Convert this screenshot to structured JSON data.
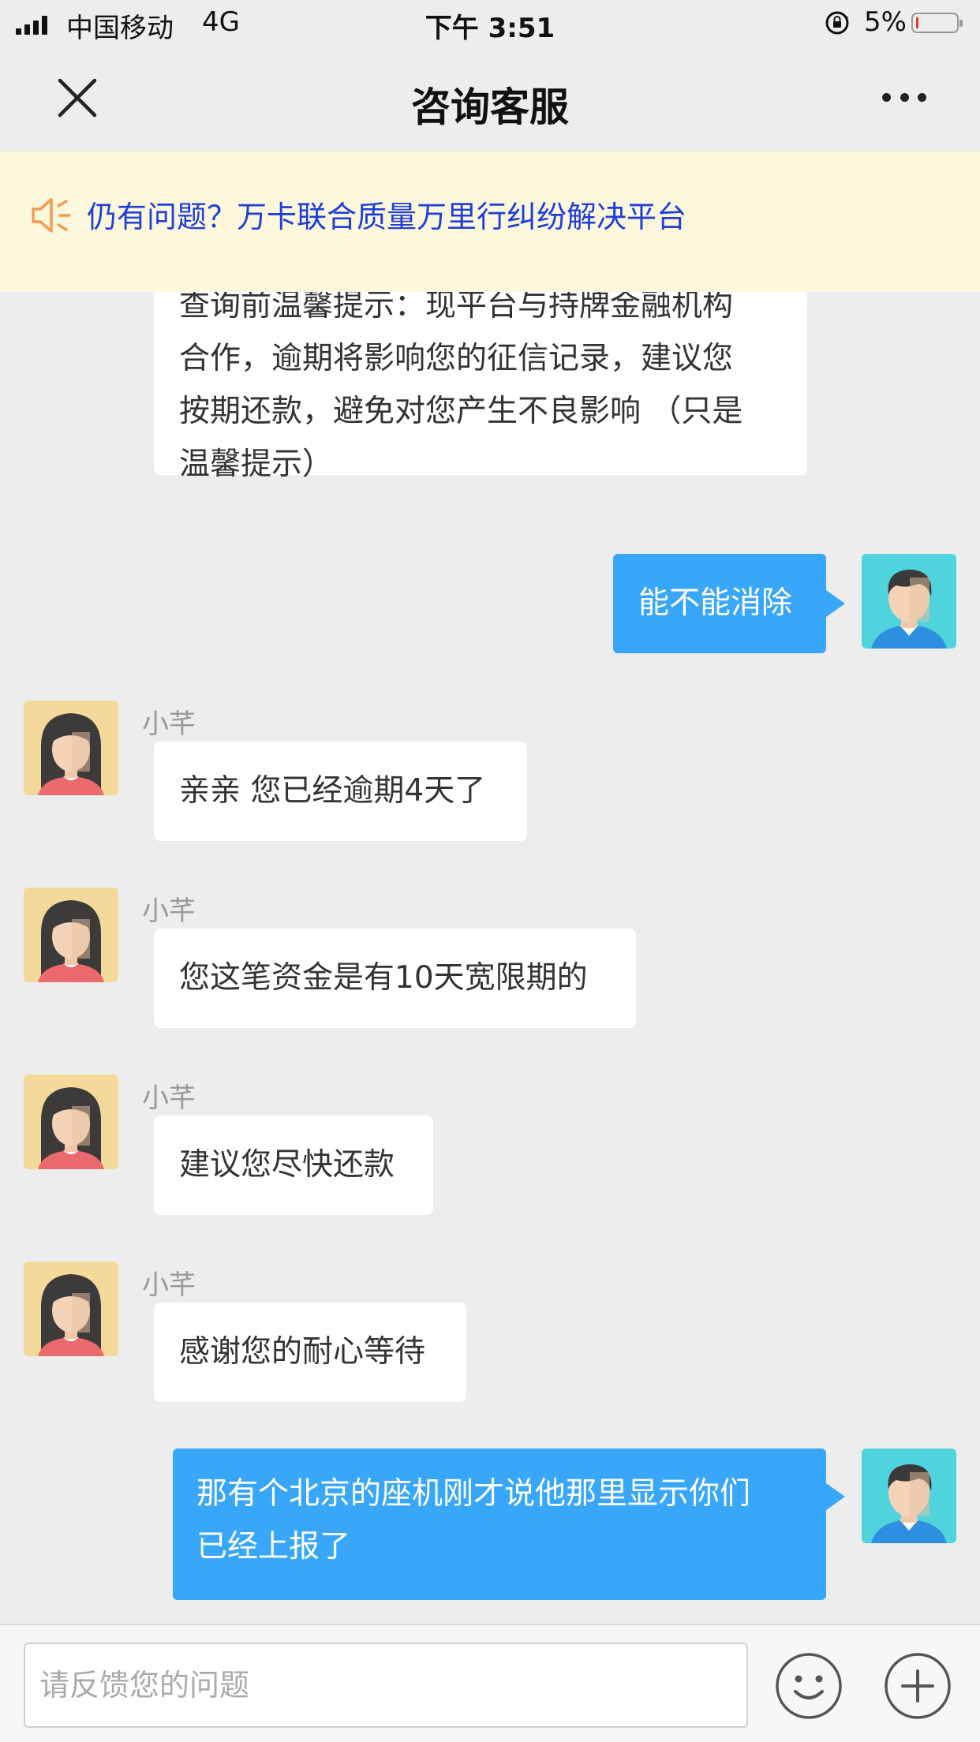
{
  "status_bar": {
    "carrier": "中国移动",
    "network": "4G",
    "time": "下午 3:51",
    "battery": "5%",
    "battery_level": 0.05
  },
  "nav": {
    "title": "咨询客服",
    "close_icon": "close-icon",
    "more_icon": "more-icon"
  },
  "notice": {
    "icon": "speaker-icon",
    "text": "仍有问题？万卡联合质量万里行纠纷解决平台"
  },
  "messages": [
    {
      "side": "in",
      "sender": "",
      "lines": [
        "查询前温馨提示：现平台与持牌金融机构",
        "合作，逾期将影响您的征信记录，建议您",
        "按期还款，避免对您产生不良影响 （只是",
        "温馨提示）"
      ]
    },
    {
      "side": "out",
      "text": "能不能消除"
    },
    {
      "side": "in",
      "sender": "小芊",
      "text": "亲亲 您已经逾期4天了"
    },
    {
      "side": "in",
      "sender": "小芊",
      "text": "您这笔资金是有10天宽限期的"
    },
    {
      "side": "in",
      "sender": "小芊",
      "text": "建议您尽快还款"
    },
    {
      "side": "in",
      "sender": "小芊",
      "text": "感谢您的耐心等待"
    },
    {
      "side": "out",
      "lines": [
        "那有个北京的座机刚才说他那里显示你们",
        "已经上报了"
      ]
    }
  ],
  "input": {
    "placeholder": "请反馈您的问题",
    "emoji_icon": "emoji-icon",
    "add_icon": "plus-icon"
  },
  "colors": {
    "outgoing_bubble": "#38a6f9",
    "notice_bg": "#fdf7dc",
    "notice_text": "#1f3fd8",
    "notice_icon": "#f29b51"
  }
}
